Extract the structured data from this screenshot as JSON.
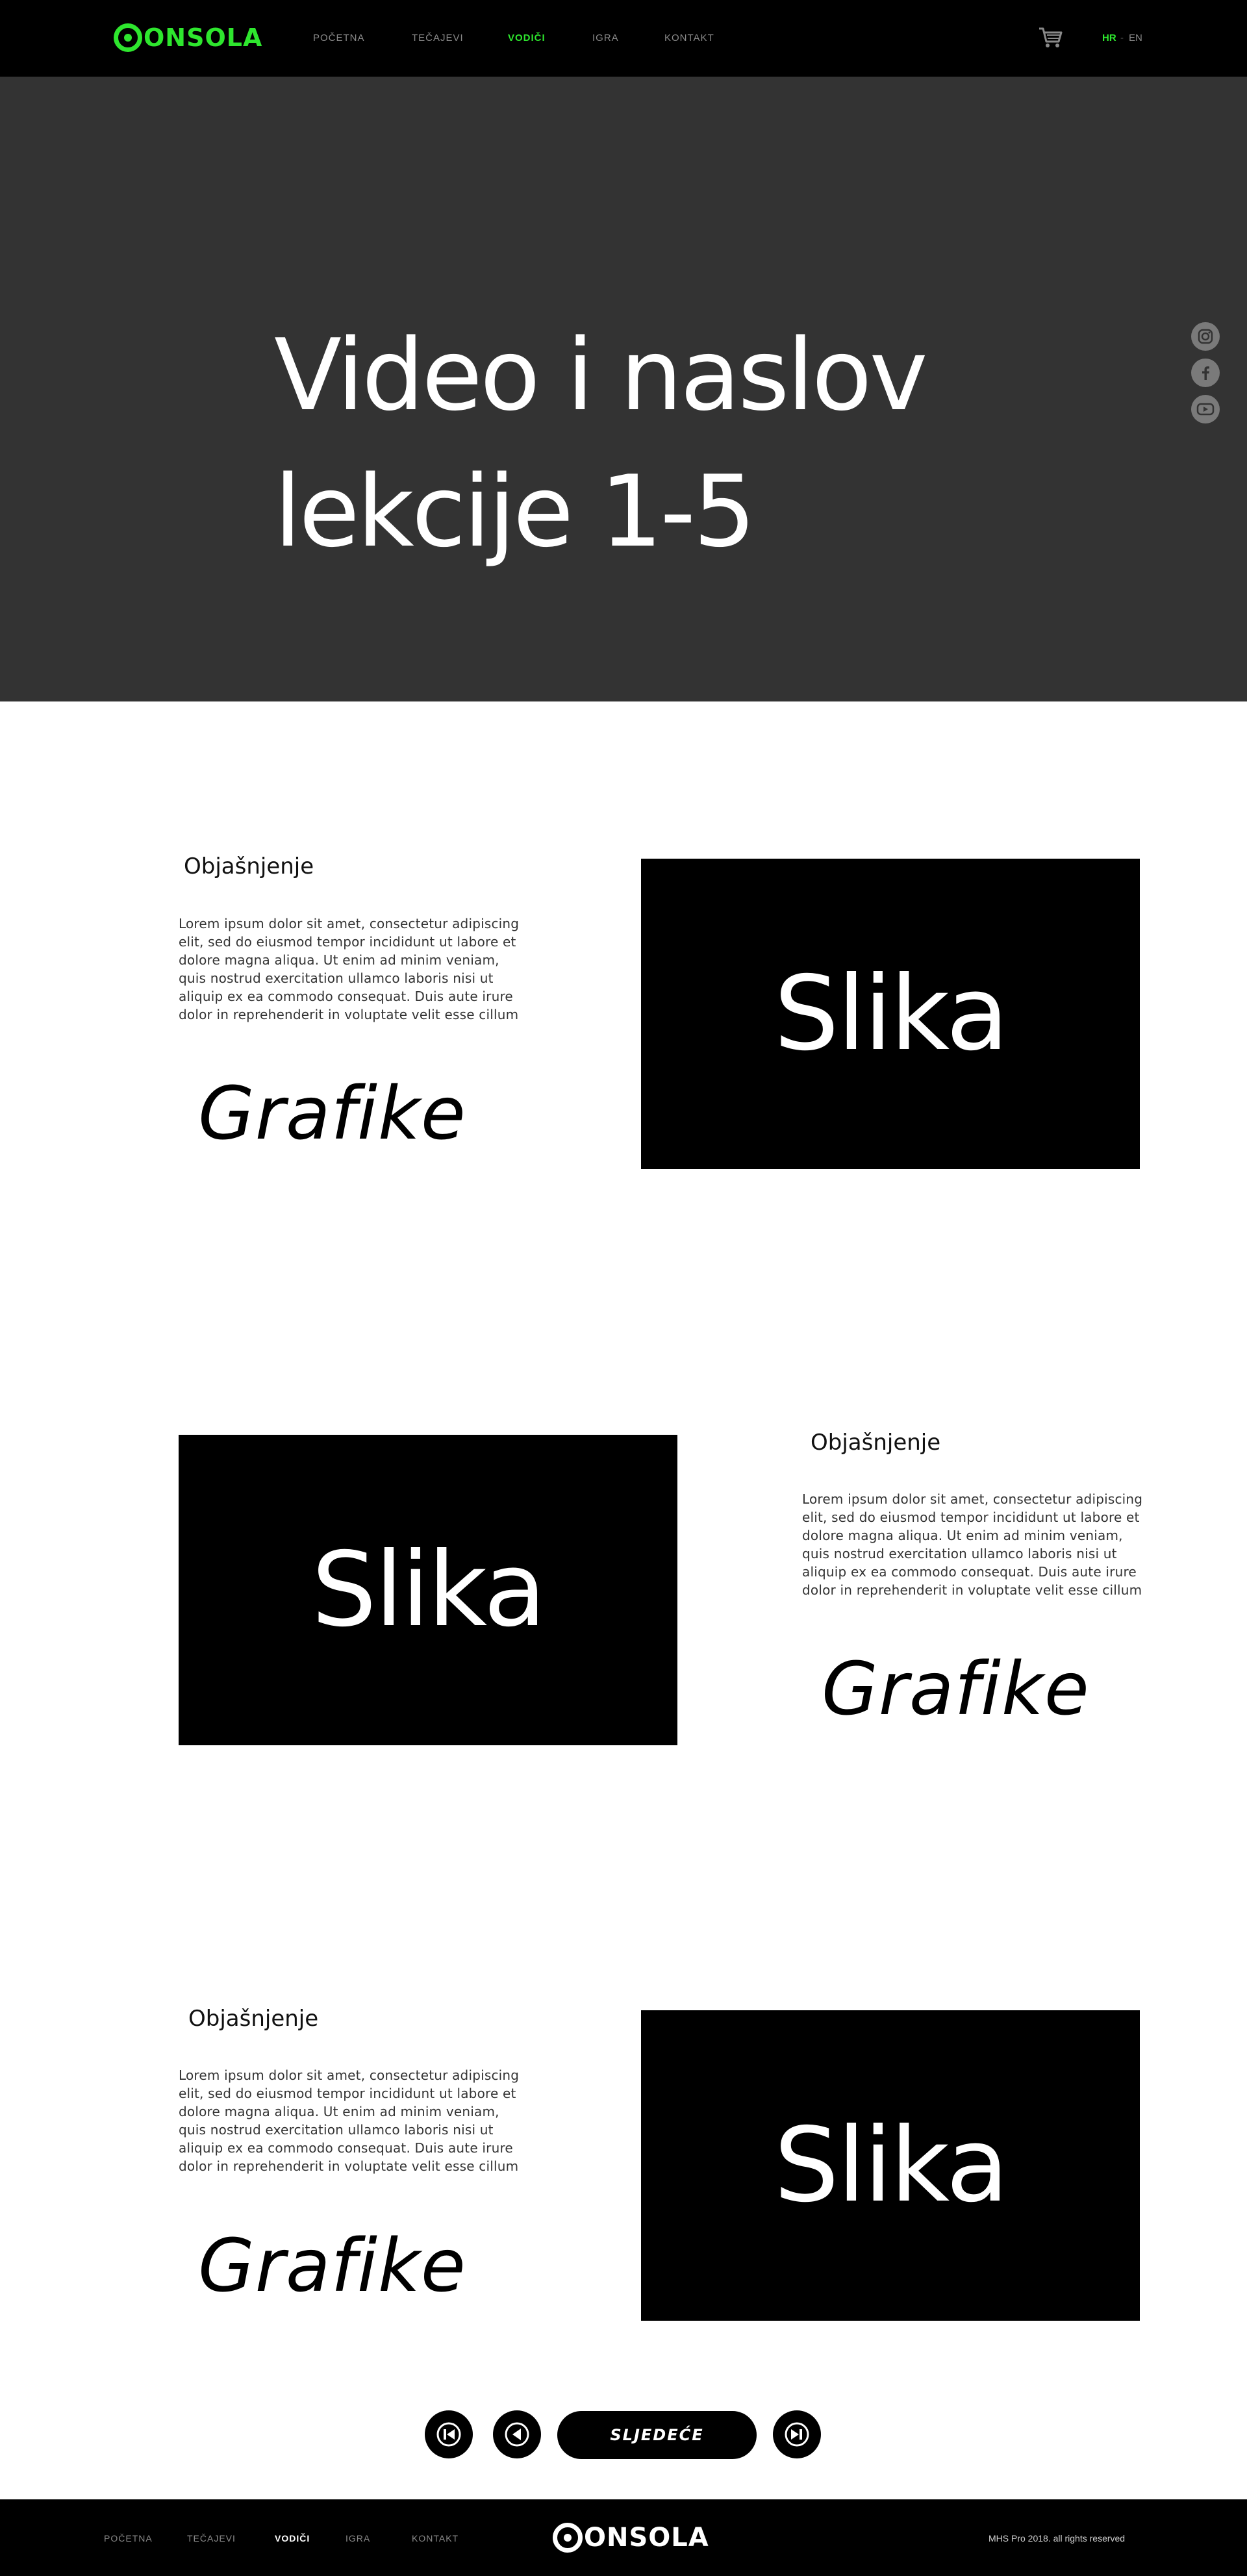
{
  "colors": {
    "accent": "#2ee62e",
    "hero_bg": "#333333",
    "nav_bg": "#000000"
  },
  "nav": {
    "logo": "ONSOLA",
    "links": [
      "POČETNA",
      "TEČAJEVI",
      "VODIČI",
      "IGRA",
      "KONTAKT"
    ],
    "active": "VODIČI",
    "cart_icon": "cart-icon",
    "lang_hr": "HR",
    "lang_sep": "-",
    "lang_en": "EN"
  },
  "hero": {
    "title_line1": "Video i naslov",
    "title_line2": "lekcije 1-5",
    "social_icons": [
      "instagram-icon",
      "facebook-icon",
      "youtube-icon"
    ]
  },
  "sections": [
    {
      "heading": "Objašnjenje",
      "text": "Lorem ipsum dolor sit amet, consectetur adipiscing elit, sed do eiusmod tempor incididunt ut labore et dolore magna aliqua. Ut enim ad minim veniam, quis nostrud exercitation ullamco laboris nisi ut aliquip ex ea commodo consequat. Duis aute irure dolor in reprehenderit in voluptate velit esse cillum",
      "graphics": "Grafike",
      "image": "Slika"
    },
    {
      "heading": "Objašnjenje",
      "text": "Lorem ipsum dolor sit amet, consectetur adipiscing elit, sed do eiusmod tempor incididunt ut labore et dolore magna aliqua. Ut enim ad minim veniam, quis nostrud exercitation ullamco laboris nisi ut aliquip ex ea commodo consequat. Duis aute irure dolor in reprehenderit in voluptate velit esse cillum",
      "graphics": "Grafike",
      "image": "Slika"
    },
    {
      "heading": "Objašnjenje",
      "text": "Lorem ipsum dolor sit amet, consectetur adipiscing elit, sed do eiusmod tempor incididunt ut labore et dolore magna aliqua. Ut enim ad minim veniam, quis nostrud exercitation ullamco laboris nisi ut aliquip ex ea commodo consequat. Duis aute irure dolor in reprehenderit in voluptate velit esse cillum",
      "graphics": "Grafike",
      "image": "Slika"
    }
  ],
  "pager": {
    "next_label": "SLJEDEĆE"
  },
  "footer": {
    "links": [
      "POČETNA",
      "TEČAJEVI",
      "VODIČI",
      "IGRA",
      "KONTAKT"
    ],
    "active": "VODIČI",
    "logo": "ONSOLA",
    "copyright": "MHS Pro 2018. all rights reserved"
  }
}
